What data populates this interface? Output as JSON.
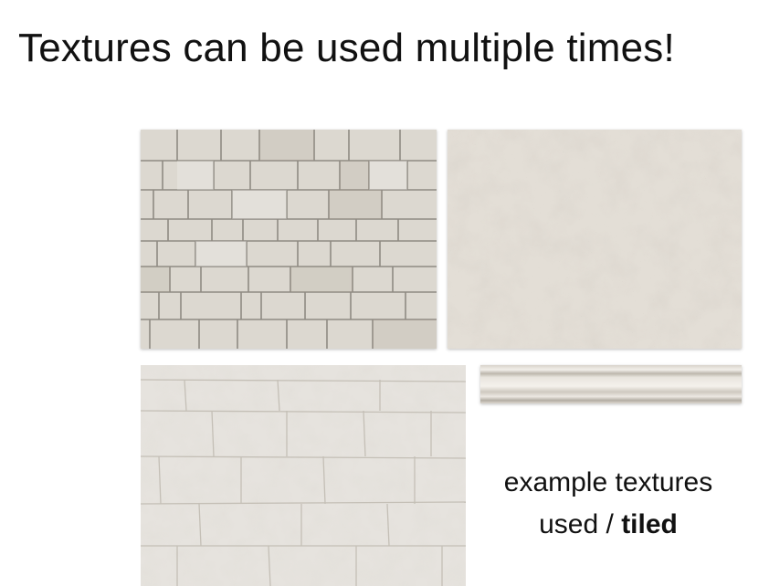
{
  "slide": {
    "title": "Textures can be used multiple times!",
    "caption_line1": "example textures",
    "caption_line2_prefix": "used / ",
    "caption_line2_bold": "tiled"
  },
  "textures": [
    {
      "name": "stone-brick-wall-texture"
    },
    {
      "name": "plaster-concrete-texture"
    },
    {
      "name": "rough-limestone-wall-texture"
    },
    {
      "name": "molding-trim-texture"
    }
  ],
  "colors": {
    "background": "#ffffff",
    "stone_base": "#dcd8d0",
    "mortar": "#9a958d",
    "plaster": "#e2ddd5"
  }
}
